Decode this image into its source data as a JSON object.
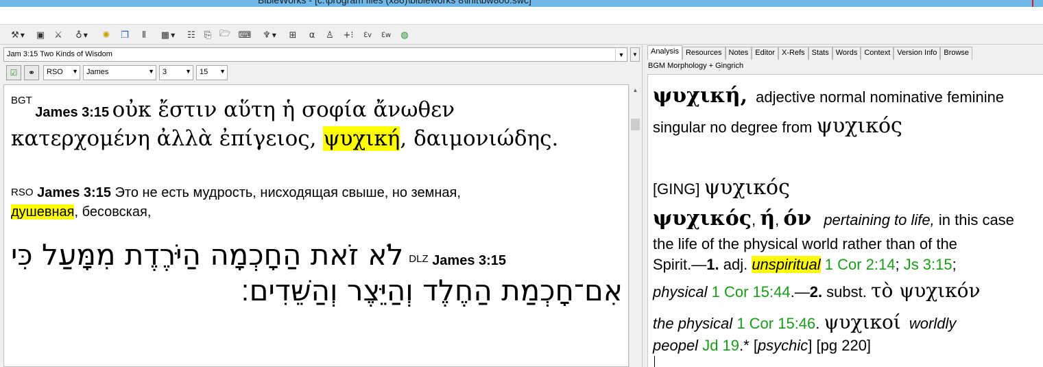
{
  "window": {
    "title": "BibleWorks - [c:\\program files (x86)\\bibleworks 8\\init\\bw800.swc]"
  },
  "toolbar": {
    "icons": [
      "copy-icon",
      "save-icon",
      "tools-icon",
      "search-icon",
      "lamp-icon",
      "windows-icon",
      "verse-icon",
      "grid-icon",
      "table-icon",
      "copy-pages-icon",
      "folder-icon",
      "keyboard-icon",
      "lamp2-icon",
      "tile-icon",
      "alpha-icon",
      "person-icon",
      "plus-icon",
      "ev-icon",
      "ew-icon",
      "globe-icon"
    ]
  },
  "left": {
    "verse_selector": "Jam 3:15 Two Kinds of Wisdom",
    "version_select": "RSO",
    "book_select": "James",
    "chapter_select": "3",
    "verse_select": "15"
  },
  "bgt": {
    "version": "BGT",
    "ref": "James 3:15",
    "line1": "οὐκ ἔστιν αὕτη ἡ σοφία ἄνωθεν",
    "line2_a": "κατερχομένη ἀλλὰ ἐπίγειος, ",
    "line2_hl": "ψυχική",
    "line2_b": ", δαιμονιώδης."
  },
  "rso": {
    "version": "RSO",
    "ref": "James 3:15",
    "line1": "Это не есть мудрость, нисходящая свыше, но земная,",
    "line2_hl": "душевная",
    "line2_b": ", бесовская,"
  },
  "dlz": {
    "version": "DLZ",
    "ref": "James 3:15",
    "line1": "לֹא זֹאת הַחָכְמָה הַיֹּרֶדֶת מִמָּעַל כִּי",
    "line2": "אִם־חָכְמַת הַחֶלֶד וְהַיֵּצֶר וְהַשֵּׁדִים׃"
  },
  "right": {
    "tabs": [
      "Analysis",
      "Resources",
      "Notes",
      "Editor",
      "X-Refs",
      "Stats",
      "Words",
      "Context",
      "Version Info",
      "Browse"
    ],
    "subtitle": "BGM Morphology + Gingrich",
    "morph_word": "ψυχική,",
    "morph_desc1": "adjective normal nominative feminine",
    "morph_desc2": "singular no degree from",
    "morph_lemma": "ψυχικός",
    "ging_label": "[GING]",
    "ging_lemma": "ψυχικός",
    "entry_word": "ψυχικός",
    "entry_sep1": ", ",
    "entry_f": "ή",
    "entry_sep2": ", ",
    "entry_n": "όν",
    "def1_it": "pertaining to life,",
    "def1": " in this case",
    "def2": "the life of the physical world rather than of the",
    "def3_a": "Spirit.—",
    "def3_b": "1.",
    "def3_c": " adj. ",
    "def3_hl": "unspiritual",
    "def3_sp": " ",
    "ref1": "1 Cor 2:14",
    "def3_sep": "; ",
    "ref2": "Js 3:15",
    "def3_end": ";",
    "def4_it": "physical",
    "def4_sp": " ",
    "ref3": "1 Cor 15:44",
    "def4_a": ".—",
    "def4_b": "2.",
    "def4_c": " subst. ",
    "def4_gk": "τὸ ψυχικόν",
    "def5_it": "the physical",
    "def5_sp": " ",
    "ref4": "1 Cor 15:46",
    "def5_a": ". ",
    "def5_gk": "ψυχικοί",
    "def5_it2": "worldly",
    "def6_it": "peopel",
    "def6_sp": " ",
    "ref5": "Jd 19",
    "def6_a": ".* [",
    "def6_it2": "psychic",
    "def6_b": "] [pg 220]"
  }
}
